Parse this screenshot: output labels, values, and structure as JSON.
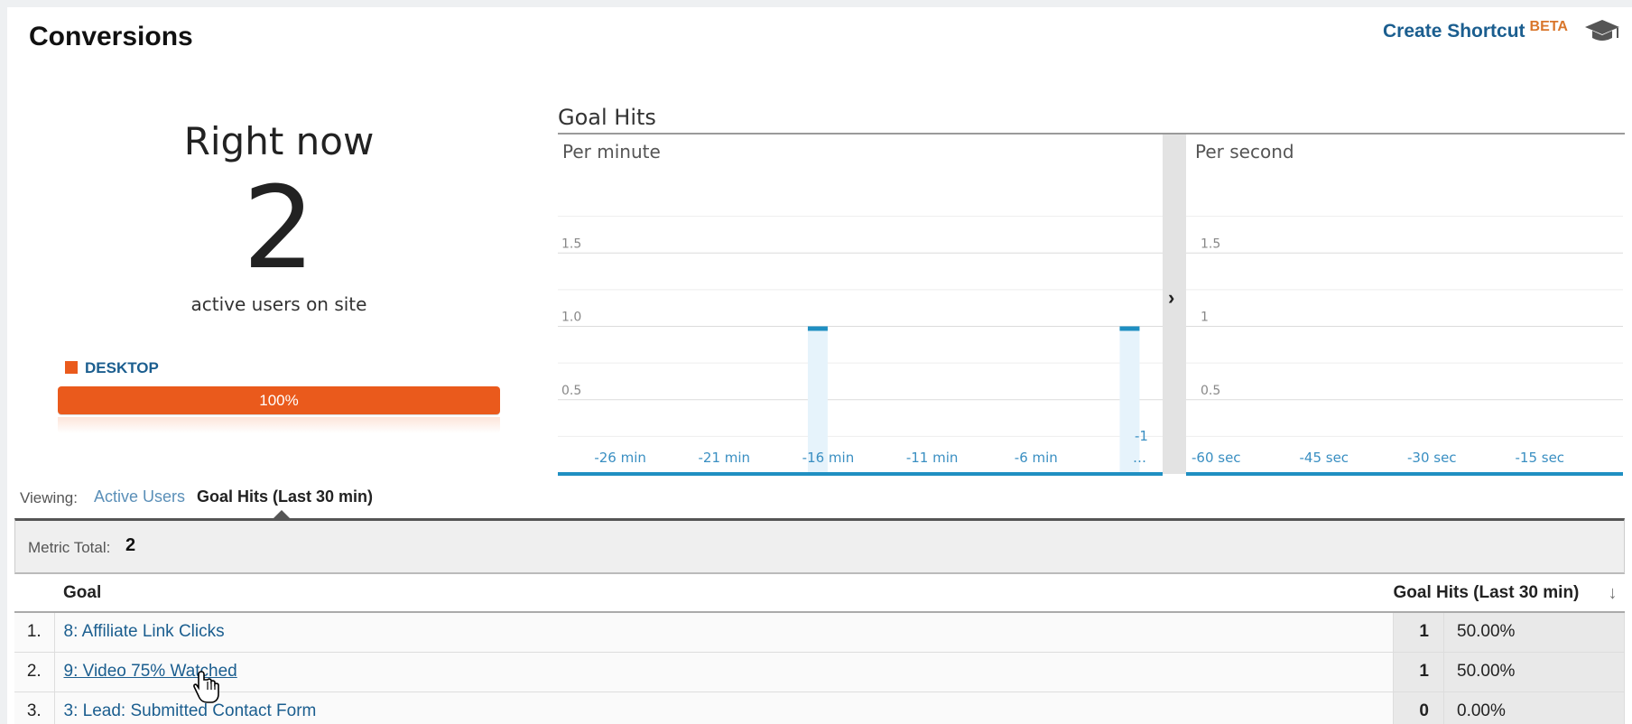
{
  "header": {
    "title": "Conversions",
    "create_shortcut": "Create Shortcut",
    "beta": "BETA",
    "help_icon": "graduation-cap-icon"
  },
  "right_now": {
    "title": "Right now",
    "value": "2",
    "subtitle": "active users on site",
    "device": {
      "name": "DESKTOP",
      "percent_label": "100%",
      "share": 1.0,
      "color": "#ea5a1c"
    }
  },
  "goal_hits_chart": {
    "title": "Goal Hits",
    "per_minute_label": "Per minute",
    "per_second_label": "Per second",
    "expand_icon": "chevron-right-icon"
  },
  "chart_data": [
    {
      "type": "bar",
      "title": "Per minute",
      "y_ticks": [
        "1.5",
        "1.0",
        "0.5"
      ],
      "ylim": [
        0,
        2
      ],
      "x_ticks": [
        "-26 min",
        "-21 min",
        "-16 min",
        "-11 min",
        "-6 min",
        "-1 …"
      ],
      "tick_minutes": [
        -26,
        -21,
        -16,
        -11,
        -6,
        -1
      ],
      "xlim": [
        -29,
        0
      ],
      "bars": [
        {
          "minute": -17,
          "value": 1
        },
        {
          "minute": -2,
          "value": 1
        }
      ],
      "bar_color": "#1f8fc2",
      "highlight_color": "#e6f3fb"
    },
    {
      "type": "bar",
      "title": "Per second",
      "y_ticks": [
        "1.5",
        "1",
        "0.5"
      ],
      "ylim": [
        0,
        2
      ],
      "x_ticks": [
        "-60 sec",
        "-45 sec",
        "-30 sec",
        "-15 sec"
      ],
      "tick_seconds": [
        -60,
        -45,
        -30,
        -15
      ],
      "xlim": [
        -60,
        0
      ],
      "bars": []
    }
  ],
  "viewing": {
    "label": "Viewing:",
    "active_users": "Active Users",
    "goal_hits": "Goal Hits (Last 30 min)"
  },
  "metric_total": {
    "label": "Metric Total:",
    "value": "2"
  },
  "table": {
    "col_goal": "Goal",
    "col_hits": "Goal Hits (Last 30 min)",
    "sort_icon": "arrow-down-icon",
    "rows": [
      {
        "index": "1.",
        "goal": "8: Affiliate Link Clicks",
        "hits": "1",
        "percent": "50.00%"
      },
      {
        "index": "2.",
        "goal": "9: Video 75% Watched",
        "hits": "1",
        "percent": "50.00%"
      },
      {
        "index": "3.",
        "goal": "3: Lead: Submitted Contact Form",
        "hits": "0",
        "percent": "0.00%"
      }
    ]
  }
}
